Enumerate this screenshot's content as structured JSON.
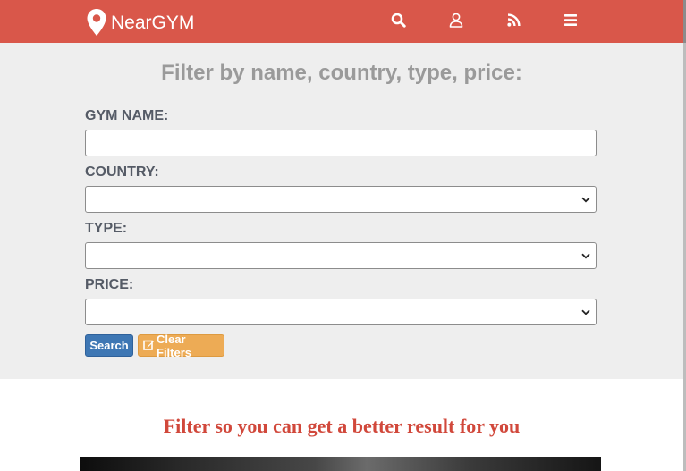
{
  "navbar": {
    "brand": "NearGYM",
    "icons": [
      "search-icon",
      "user-icon",
      "rss-icon",
      "menu-icon"
    ],
    "color": "#d9574a"
  },
  "filter": {
    "title": "Filter by name, country, type, price:",
    "fields": {
      "gym_name_label": "GYM NAME:",
      "gym_name_value": "",
      "country_label": "COUNTRY:",
      "country_value": "",
      "type_label": "TYPE:",
      "type_value": "",
      "price_label": "PRICE:",
      "price_value": ""
    },
    "search_button": "Search",
    "clear_button": "Clear Filters"
  },
  "content": {
    "tagline": "Filter so you can get a better result for you"
  }
}
